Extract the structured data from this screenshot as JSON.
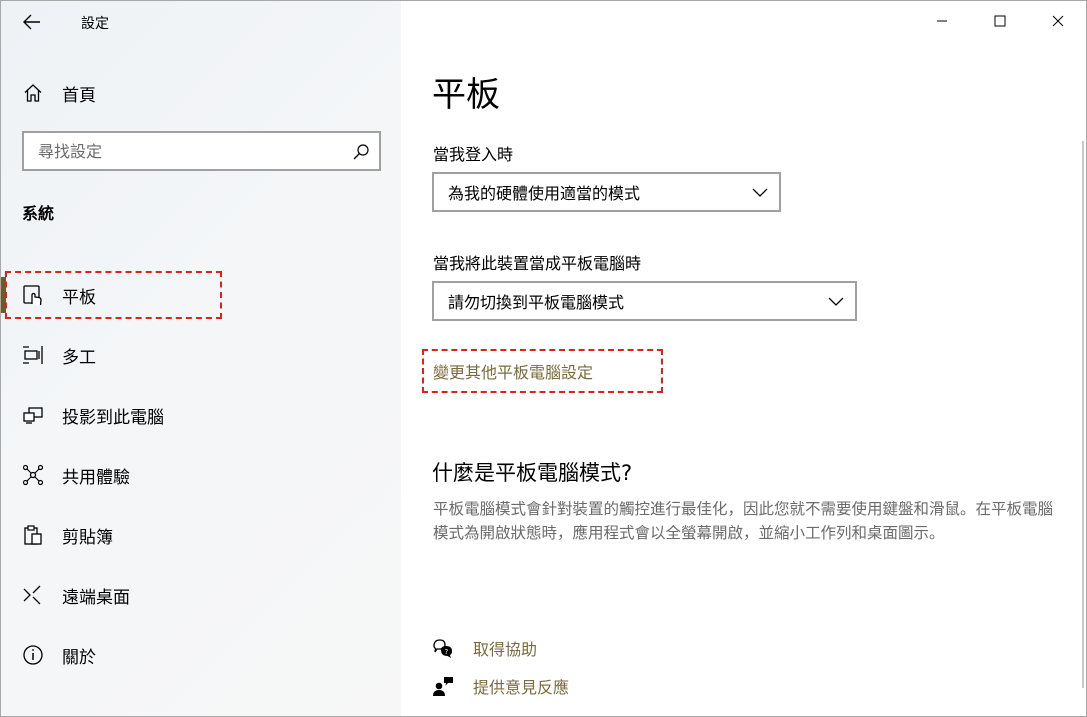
{
  "window": {
    "title": "設定"
  },
  "nav": {
    "home_label": "首頁",
    "search_placeholder": "尋找設定",
    "section": "系統",
    "items": [
      {
        "label": "平板",
        "icon": "tablet-icon",
        "selected": true
      },
      {
        "label": "多工",
        "icon": "multitasking-icon",
        "selected": false
      },
      {
        "label": "投影到此電腦",
        "icon": "project-icon",
        "selected": false
      },
      {
        "label": "共用體驗",
        "icon": "shared-experiences-icon",
        "selected": false
      },
      {
        "label": "剪貼簿",
        "icon": "clipboard-icon",
        "selected": false
      },
      {
        "label": "遠端桌面",
        "icon": "remote-desktop-icon",
        "selected": false
      },
      {
        "label": "關於",
        "icon": "info-icon",
        "selected": false
      }
    ]
  },
  "main": {
    "title": "平板",
    "signin": {
      "label": "當我登入時",
      "value": "為我的硬體使用適當的模式"
    },
    "tablet_use": {
      "label": "當我將此裝置當成平板電腦時",
      "value": "請勿切換到平板電腦模式"
    },
    "more_link": "變更其他平板電腦設定",
    "what_title": "什麼是平板電腦模式?",
    "what_desc": "平板電腦模式會針對裝置的觸控進行最佳化，因此您就不需要使用鍵盤和滑鼠。在平板電腦模式為開啟狀態時，應用程式會以全螢幕開啟，並縮小工作列和桌面圖示。",
    "help": {
      "get_help": "取得協助",
      "feedback": "提供意見反應"
    }
  },
  "colors": {
    "accent": "#6b5a2a",
    "link": "#7a6a3c",
    "highlight": "#e0201b"
  }
}
